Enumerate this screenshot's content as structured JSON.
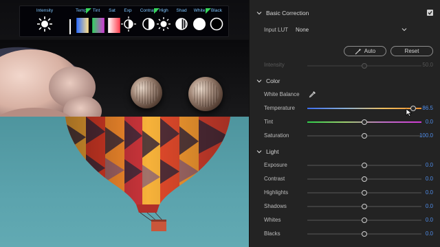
{
  "device": {
    "screen_items": [
      {
        "label": "Intensity",
        "icon": "sun-icon"
      },
      {
        "label": "Temp",
        "icon": "temperature-gradient-icon"
      },
      {
        "label": "Tint",
        "icon": "tint-gradient-icon"
      },
      {
        "label": "Sat",
        "icon": "saturation-gradient-icon"
      },
      {
        "label": "Exp",
        "icon": "exposure-icon"
      },
      {
        "label": "Contrast",
        "icon": "contrast-icon"
      },
      {
        "label": "High",
        "icon": "highlights-icon"
      },
      {
        "label": "Shad",
        "icon": "shadows-icon"
      },
      {
        "label": "White",
        "icon": "whites-icon"
      },
      {
        "label": "Black",
        "icon": "blacks-icon"
      }
    ],
    "accent": "#7fc6ff"
  },
  "panel": {
    "title": "Basic Correction",
    "enabled": true,
    "input_lut": {
      "label": "Input LUT",
      "value": "None"
    },
    "auto_label": "Auto",
    "reset_label": "Reset",
    "intensity": {
      "label": "Intensity",
      "value": "50.0",
      "level": 0.5
    },
    "color": {
      "title": "Color",
      "white_balance_label": "White Balance",
      "temperature": {
        "label": "Temperature",
        "value": "86.5",
        "level": 0.93
      },
      "tint": {
        "label": "Tint",
        "value": "0.0",
        "level": 0.5
      },
      "saturation": {
        "label": "Saturation",
        "value": "100.0",
        "level": 0.5
      }
    },
    "light": {
      "title": "Light",
      "exposure": {
        "label": "Exposure",
        "value": "0.0",
        "level": 0.5
      },
      "contrast": {
        "label": "Contrast",
        "value": "0.0",
        "level": 0.5
      },
      "highlights": {
        "label": "Highlights",
        "value": "0.0",
        "level": 0.5
      },
      "shadows": {
        "label": "Shadows",
        "value": "0.0",
        "level": 0.5
      },
      "whites": {
        "label": "Whites",
        "value": "0.0",
        "level": 0.5
      },
      "blacks": {
        "label": "Blacks",
        "value": "0.0",
        "level": 0.5
      }
    },
    "value_color": "#4f8dea"
  }
}
